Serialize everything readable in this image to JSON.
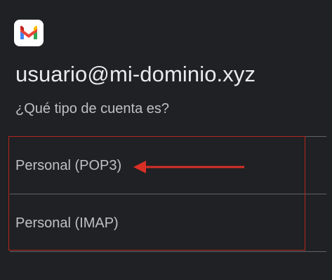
{
  "app": {
    "logo_icon": "gmail-logo-icon"
  },
  "account": {
    "email": "usuario@mi-dominio.xyz",
    "question": "¿Qué tipo de cuenta es?"
  },
  "options": [
    {
      "label": "Personal (POP3)"
    },
    {
      "label": "Personal (IMAP)"
    }
  ],
  "annotation": {
    "highlight_color": "#b3261e",
    "arrow_color": "#d93025",
    "arrow_icon": "left-arrow-icon"
  },
  "colors": {
    "background": "#202124",
    "primary_text": "#e8eaed",
    "secondary_text": "#bdc1c6",
    "divider": "#5f6368"
  }
}
